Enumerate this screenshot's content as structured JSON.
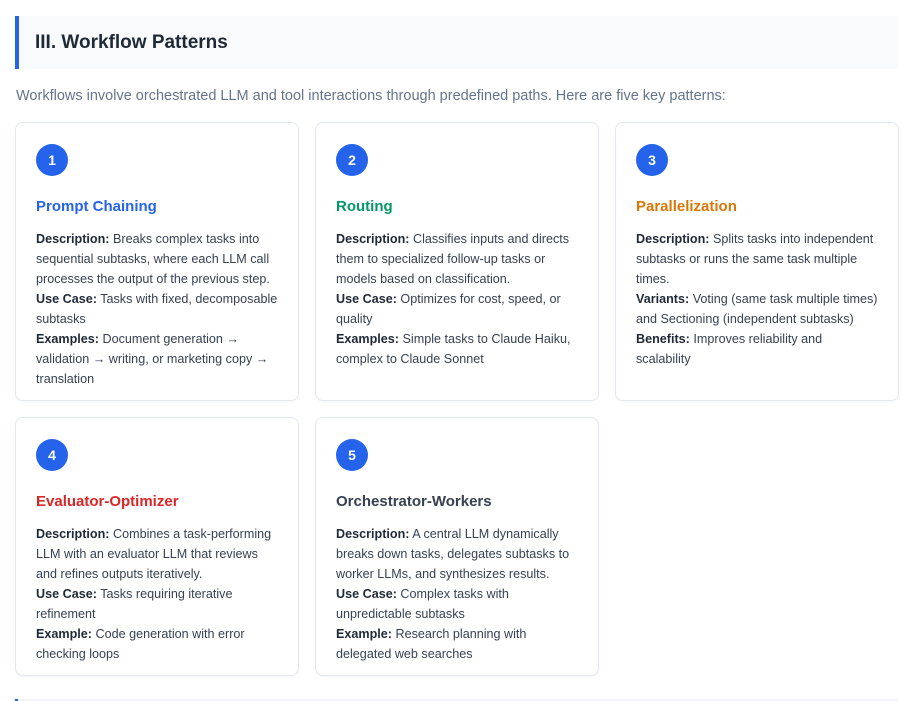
{
  "section": {
    "title": "III. Workflow Patterns",
    "intro": "Workflows involve orchestrated LLM and tool interactions through predefined paths. Here are five key patterns:"
  },
  "colors": {
    "accent": "#2563eb",
    "prompt_chaining": "#2563eb",
    "routing": "#059669",
    "parallelization": "#d97706",
    "evaluator_optimizer": "#dc2626",
    "orchestrator_workers": "#374151"
  },
  "cards": [
    {
      "number": "1",
      "title": "Prompt Chaining",
      "fields": [
        {
          "label": "Description:",
          "text": "Breaks complex tasks into sequential subtasks, where each LLM call processes the output of the previous step."
        },
        {
          "label": "Use Case:",
          "text": "Tasks with fixed, decomposable subtasks"
        },
        {
          "label": "Examples:",
          "text": "Document generation → validation → writing, or marketing copy → translation"
        }
      ]
    },
    {
      "number": "2",
      "title": "Routing",
      "fields": [
        {
          "label": "Description:",
          "text": "Classifies inputs and directs them to specialized follow-up tasks or models based on classification."
        },
        {
          "label": "Use Case:",
          "text": "Optimizes for cost, speed, or quality"
        },
        {
          "label": "Examples:",
          "text": "Simple tasks to Claude Haiku, complex to Claude Sonnet"
        }
      ]
    },
    {
      "number": "3",
      "title": "Parallelization",
      "fields": [
        {
          "label": "Description:",
          "text": "Splits tasks into independent subtasks or runs the same task multiple times."
        },
        {
          "label": "Variants:",
          "text": "Voting (same task multiple times) and Sectioning (independent subtasks)"
        },
        {
          "label": "Benefits:",
          "text": "Improves reliability and scalability"
        }
      ]
    },
    {
      "number": "4",
      "title": "Evaluator-Optimizer",
      "fields": [
        {
          "label": "Description:",
          "text": "Combines a task-performing LLM with an evaluator LLM that reviews and refines outputs iteratively."
        },
        {
          "label": "Use Case:",
          "text": "Tasks requiring iterative refinement"
        },
        {
          "label": "Example:",
          "text": "Code generation with error checking loops"
        }
      ]
    },
    {
      "number": "5",
      "title": "Orchestrator-Workers",
      "fields": [
        {
          "label": "Description:",
          "text": "A central LLM dynamically breaks down tasks, delegates subtasks to worker LLMs, and synthesizes results."
        },
        {
          "label": "Use Case:",
          "text": "Complex tasks with unpredictable subtasks"
        },
        {
          "label": "Example:",
          "text": "Research planning with delegated web searches"
        }
      ]
    }
  ]
}
